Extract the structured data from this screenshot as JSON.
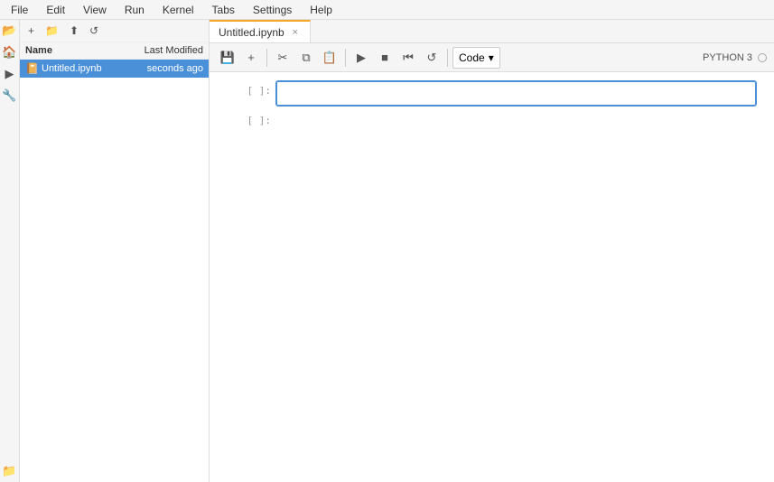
{
  "menubar": {
    "items": [
      "File",
      "Edit",
      "View",
      "Run",
      "Kernel",
      "Tabs",
      "Settings",
      "Help"
    ]
  },
  "sidebar": {
    "icons": [
      "folder-open-icon",
      "folder-icon",
      "upload-icon",
      "refresh-icon",
      "home-icon",
      "tool-icon",
      "tag-icon",
      "folder-plus-icon"
    ]
  },
  "file_panel": {
    "toolbar_buttons": [
      "+",
      "📁",
      "⬆",
      "🔄"
    ],
    "header_name": "Name",
    "header_modified": "Last Modified",
    "files": [
      {
        "name": "Untitled.ipynb",
        "modified": "seconds ago",
        "icon": "notebook"
      }
    ]
  },
  "tab": {
    "title": "Untitled.ipynb",
    "close_label": "×"
  },
  "toolbar": {
    "save_label": "💾",
    "add_label": "+",
    "cut_label": "✂",
    "copy_label": "⧉",
    "paste_label": "⧉",
    "run_label": "▶",
    "stop_label": "■",
    "restart_label": "⏮",
    "refresh_label": "↺",
    "cell_type": "Code",
    "kernel_label": "PYTHON 3"
  },
  "cells": [
    {
      "prompt": "[ ]: ",
      "active": true
    },
    {
      "prompt": "[ ]: ",
      "active": false
    }
  ]
}
